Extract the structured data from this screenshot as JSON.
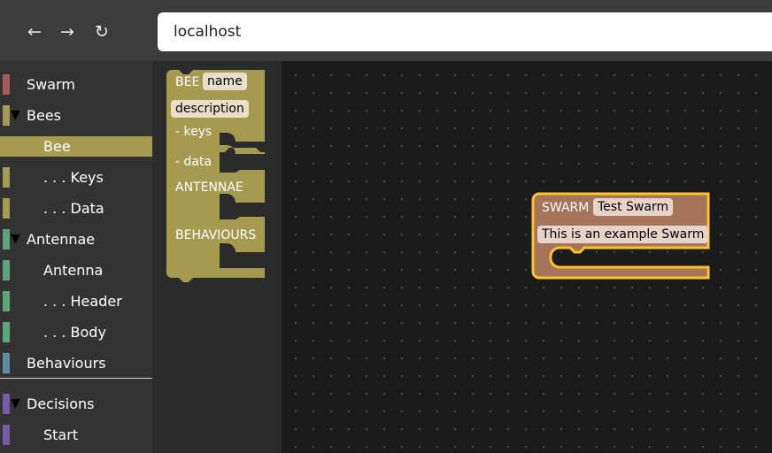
{
  "browser": {
    "url": "localhost",
    "back_icon": "←",
    "forward_icon": "→",
    "reload_icon": "↻"
  },
  "toolbox": {
    "items": [
      {
        "label": "Swarm",
        "color": "#a55b5b",
        "indent": 0,
        "expanded": null,
        "selected": false
      },
      {
        "label": "Bees",
        "color": "#a69a51",
        "indent": 0,
        "expanded": true,
        "selected": false
      },
      {
        "label": "Bee",
        "color": "#a69a51",
        "indent": 1,
        "expanded": null,
        "selected": true
      },
      {
        "label": ". . . Keys",
        "color": "#a69a51",
        "indent": 1,
        "expanded": null,
        "selected": false
      },
      {
        "label": ". . . Data",
        "color": "#a69a51",
        "indent": 1,
        "expanded": null,
        "selected": false
      },
      {
        "label": "Antennae",
        "color": "#5ba57b",
        "indent": 0,
        "expanded": true,
        "selected": false
      },
      {
        "label": "Antenna",
        "color": "#5ba57b",
        "indent": 1,
        "expanded": null,
        "selected": false
      },
      {
        "label": ". . . Header",
        "color": "#5ba57b",
        "indent": 1,
        "expanded": null,
        "selected": false
      },
      {
        "label": ". . . Body",
        "color": "#5ba57b",
        "indent": 1,
        "expanded": null,
        "selected": false
      },
      {
        "label": "Behaviours",
        "color": "#5b8ea5",
        "indent": 0,
        "expanded": null,
        "selected": false
      },
      {
        "label": "Decisions",
        "color": "#735ba5",
        "indent": 0,
        "expanded": true,
        "selected": false
      },
      {
        "label": "Start",
        "color": "#735ba5",
        "indent": 1,
        "expanded": null,
        "selected": false
      }
    ]
  },
  "bee_block": {
    "color": "#a69a51",
    "title": "BEE",
    "name_field": "name",
    "description_field": "description",
    "keys_label": "- keys",
    "data_label": "- data",
    "antennae_label": "ANTENNAE",
    "behaviours_label": "BEHAVIOURS"
  },
  "swarm_block": {
    "color": "#a5745b",
    "highlight": "#fcc426",
    "title": "SWARM",
    "name_field": "Test Swarm",
    "description_field": "This is an example Swarm"
  }
}
